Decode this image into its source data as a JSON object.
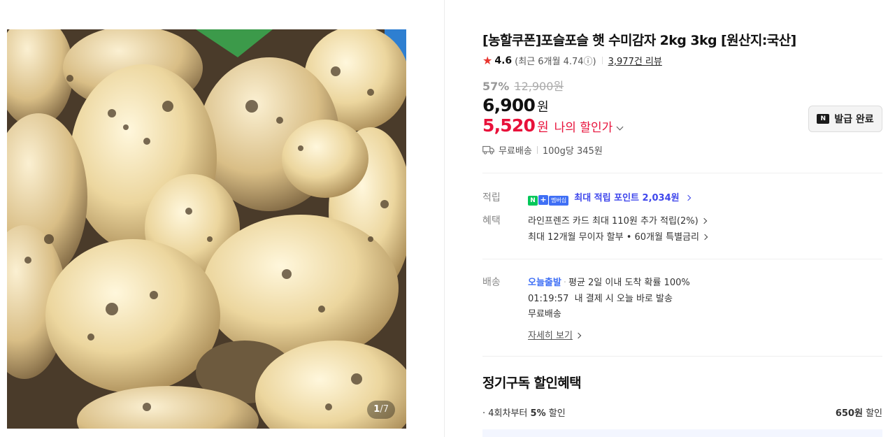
{
  "product": {
    "title": "[농할쿠폰]포슬포슬 햇 수미감자 2kg 3kg [원산지:국산]",
    "image_counter": {
      "current": "1",
      "total": "/7"
    }
  },
  "rating": {
    "score": "4.6",
    "recent": "(최근 6개월 4.74ⓘ)",
    "reviews": "3,977건 리뷰"
  },
  "price": {
    "discount_rate": "57%",
    "original": "12,900원",
    "sale": "6,900",
    "sale_unit": "원",
    "my_price": "5,520",
    "my_price_unit": "원",
    "my_price_label": "나의 할인가"
  },
  "coupon": {
    "label": "발급 완료",
    "mark": "N"
  },
  "shipping_summary": {
    "fee": "무료배송",
    "unit_price": "100g당 345원"
  },
  "points": {
    "label": "적립",
    "badge_n": "N",
    "badge_plus": "+",
    "badge_member": "멤버십",
    "text": "최대 적립 포인트 2,034원"
  },
  "benefits": {
    "label": "혜택",
    "line1": "라인프렌즈 카드 최대 110원 추가 적립(2%)",
    "line2": "최대 12개월 무이자 할부 • 60개월 특별금리"
  },
  "delivery": {
    "label": "배송",
    "today": "오늘출발",
    "avg": "평균 2일 이내 도착 확률 100%",
    "countdown": "01:19:57",
    "countdown_text": "내 결제 시 오늘 바로 발송",
    "fee": "무료배송",
    "detail_link": "자세히 보기"
  },
  "subscription": {
    "title": "정기구독 할인혜택",
    "row_prefix": "· 4회차부터",
    "row_rate": "5%",
    "row_suffix": "할인",
    "row_amount": "650원",
    "row_amount_suffix": "할인"
  },
  "colors": {
    "accent_red": "#e8113a",
    "accent_blue": "#3f47ec",
    "naver_green": "#03c75a"
  }
}
